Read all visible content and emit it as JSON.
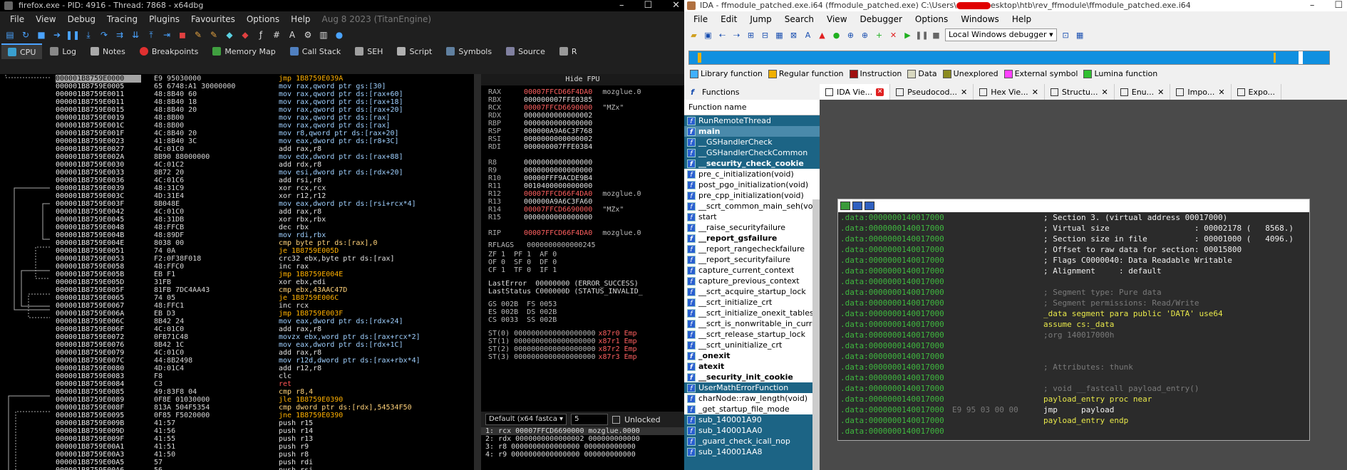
{
  "x64dbg": {
    "title": "firefox.exe - PID: 4916 - Thread: 7868 - x64dbg",
    "window_buttons": [
      "–",
      "☐",
      "✕"
    ],
    "menu": [
      "File",
      "View",
      "Debug",
      "Tracing",
      "Plugins",
      "Favourites",
      "Options",
      "Help"
    ],
    "version": "Aug 8 2023 (TitanEngine)",
    "tabs": [
      {
        "label": "CPU",
        "color": "#3aa0d0"
      },
      {
        "label": "Log",
        "color": "#888888"
      },
      {
        "label": "Notes",
        "color": "#aaaaaa"
      },
      {
        "label": "Breakpoints",
        "color": "#e03030"
      },
      {
        "label": "Memory Map",
        "color": "#40a040"
      },
      {
        "label": "Call Stack",
        "color": "#5080c0"
      },
      {
        "label": "SEH",
        "color": "#a0a0a0"
      },
      {
        "label": "Script",
        "color": "#b0b0b0"
      },
      {
        "label": "Symbols",
        "color": "#6080a0"
      },
      {
        "label": "Source",
        "color": "#8080a0"
      },
      {
        "label": "R",
        "color": "#999999"
      }
    ],
    "disasm": [
      [
        "000001B8759E0000",
        "E9 95030000",
        "jmp 1B8759E039A",
        "jmp"
      ],
      [
        "000001B8759E0005",
        "65 6748:A1 30000000",
        "mov rax,qword ptr gs:[30]",
        "mov"
      ],
      [
        "000001B8759E0011",
        "48:8B40 60",
        "mov rax,qword ptr ds:[rax+60]",
        "mov"
      ],
      [
        "000001B8759E0011",
        "48:8B40 18",
        "mov rax,qword ptr ds:[rax+18]",
        "mov"
      ],
      [
        "000001B8759E0015",
        "48:8B40 20",
        "mov rax,qword ptr ds:[rax+20]",
        "mov"
      ],
      [
        "000001B8759E0019",
        "48:8B00",
        "mov rax,qword ptr ds:[rax]",
        "mov"
      ],
      [
        "000001B8759E001C",
        "48:8B00",
        "mov rax,qword ptr ds:[rax]",
        "mov"
      ],
      [
        "000001B8759E001F",
        "4C:8B40 20",
        "mov r8,qword ptr ds:[rax+20]",
        "mov"
      ],
      [
        "000001B8759E0023",
        "41:8B40 3C",
        "mov eax,dword ptr ds:[r8+3C]",
        "mov"
      ],
      [
        "000001B8759E0027",
        "4C:01C0",
        "add rax,r8",
        ""
      ],
      [
        "000001B8759E002A",
        "8B90 88000000",
        "mov edx,dword ptr ds:[rax+88]",
        "mov"
      ],
      [
        "000001B8759E0030",
        "4C:01C2",
        "add rdx,r8",
        ""
      ],
      [
        "000001B8759E0033",
        "8B72 20",
        "mov esi,dword ptr ds:[rdx+20]",
        "mov"
      ],
      [
        "000001B8759E0036",
        "4C:01C6",
        "add rsi,r8",
        ""
      ],
      [
        "000001B8759E0039",
        "48:31C9",
        "xor rcx,rcx",
        ""
      ],
      [
        "000001B8759E003C",
        "4D:31E4",
        "xor r12,r12",
        ""
      ],
      [
        "000001B8759E003F",
        "8B048E",
        "mov eax,dword ptr ds:[rsi+rcx*4]",
        "mov"
      ],
      [
        "000001B8759E0042",
        "4C:01C0",
        "add rax,r8",
        ""
      ],
      [
        "000001B8759E0045",
        "48:31DB",
        "xor rbx,rbx",
        ""
      ],
      [
        "000001B8759E0048",
        "48:FFCB",
        "dec rbx",
        ""
      ],
      [
        "000001B8759E004B",
        "48:89DF",
        "mov rdi,rbx",
        "mov"
      ],
      [
        "000001B8759E004E",
        "8038 00",
        "cmp byte ptr ds:[rax],0",
        "cmp"
      ],
      [
        "000001B8759E0051",
        "74 0A",
        "je 1B8759E005D",
        "jmp"
      ],
      [
        "000001B8759E0053",
        "F2:0F38F018",
        "crc32 ebx,byte ptr ds:[rax]",
        ""
      ],
      [
        "000001B8759E0058",
        "48:FFC0",
        "inc rax",
        ""
      ],
      [
        "000001B8759E005B",
        "EB F1",
        "jmp 1B8759E004E",
        "jmp"
      ],
      [
        "000001B8759E005D",
        "31FB",
        "xor ebx,edi",
        ""
      ],
      [
        "000001B8759E005F",
        "81FB 7DC4AA43",
        "cmp ebx,43AAC47D",
        "cmp"
      ],
      [
        "000001B8759E0065",
        "74 05",
        "je 1B8759E006C",
        "jmp"
      ],
      [
        "000001B8759E0067",
        "48:FFC1",
        "inc rcx",
        ""
      ],
      [
        "000001B8759E006A",
        "EB D3",
        "jmp 1B8759E003F",
        "jmp"
      ],
      [
        "000001B8759E006C",
        "8B42 24",
        "mov eax,dword ptr ds:[rdx+24]",
        "mov"
      ],
      [
        "000001B8759E006F",
        "4C:01C0",
        "add rax,r8",
        ""
      ],
      [
        "000001B8759E0072",
        "0FB71C48",
        "movzx ebx,word ptr ds:[rax+rcx*2]",
        "mov"
      ],
      [
        "000001B8759E0076",
        "8B42 1C",
        "mov eax,dword ptr ds:[rdx+1C]",
        "mov"
      ],
      [
        "000001B8759E0079",
        "4C:01C0",
        "add rax,r8",
        ""
      ],
      [
        "000001B8759E007C",
        "44:8B2498",
        "mov r12d,dword ptr ds:[rax+rbx*4]",
        "mov"
      ],
      [
        "000001B8759E0080",
        "4D:01C4",
        "add r12,r8",
        ""
      ],
      [
        "000001B8759E0083",
        "F8",
        "clc",
        ""
      ],
      [
        "000001B8759E0084",
        "C3",
        "ret",
        "ret"
      ],
      [
        "000001B8759E0085",
        "49:83F8 04",
        "cmp r8,4",
        "cmp"
      ],
      [
        "000001B8759E0089",
        "0F8E 01030000",
        "jle 1B8759E0390",
        "jmp"
      ],
      [
        "000001B8759E008F",
        "813A 504F5354",
        "cmp dword ptr ds:[rdx],54534F50",
        "cmp"
      ],
      [
        "000001B8759E0095",
        "0F85 F5020000",
        "jne 1B8759E0390",
        "jmp"
      ],
      [
        "000001B8759E009B",
        "41:57",
        "push r15",
        ""
      ],
      [
        "000001B8759E009D",
        "41:56",
        "push r14",
        ""
      ],
      [
        "000001B8759E009F",
        "41:55",
        "push r13",
        ""
      ],
      [
        "000001B8759E00A1",
        "41:51",
        "push r9",
        ""
      ],
      [
        "000001B8759E00A3",
        "41:50",
        "push r8",
        ""
      ],
      [
        "000001B8759E00A5",
        "57",
        "push rdi",
        ""
      ],
      [
        "000001B8759E00A6",
        "56",
        "push rsi",
        ""
      ]
    ],
    "regs_header": "Hide FPU",
    "registers": [
      [
        "RAX",
        "00007FFCD66F4DA0",
        "mozglue.0",
        true
      ],
      [
        "RBX",
        "000000007FFE0385",
        "",
        false
      ],
      [
        "RCX",
        "00007FFCD6690000",
        "\"MZx\"",
        true
      ],
      [
        "RDX",
        "0000000000000002",
        "",
        false
      ],
      [
        "RBP",
        "0000000000000000",
        "",
        false
      ],
      [
        "RSP",
        "000000A9A6C3F768",
        "",
        false
      ],
      [
        "RSI",
        "0000000000000002",
        "",
        false
      ],
      [
        "RDI",
        "000000007FFE0384",
        "",
        false
      ],
      [
        "",
        "",
        "",
        false
      ],
      [
        "R8",
        "0000000000000000",
        "",
        false
      ],
      [
        "R9",
        "0000000000000000",
        "",
        false
      ],
      [
        "R10",
        "00000FFF9ACDE9B4",
        "",
        false
      ],
      [
        "R11",
        "0010400000000000",
        "",
        false
      ],
      [
        "R12",
        "00007FFCD66F4DA0",
        "mozglue.0",
        true
      ],
      [
        "R13",
        "000000A9A6C3FA60",
        "",
        false
      ],
      [
        "R14",
        "00007FFCD6690000",
        "\"MZx\"",
        true
      ],
      [
        "R15",
        "0000000000000000",
        "",
        false
      ],
      [
        "",
        "",
        "",
        false
      ],
      [
        "RIP",
        "00007FFCD66F4DA0",
        "mozglue.0",
        true
      ]
    ],
    "flags_line": "RFLAGS   0000000000000245",
    "flags": [
      "ZF 1  PF 1  AF 0",
      "OF 0  SF 0  DF 0",
      "CF 1  TF 0  IF 1"
    ],
    "last_error": "LastError  00000000 (ERROR_SUCCESS)",
    "last_status": "LastStatus C000000D (STATUS_INVALID_",
    "segs": [
      "GS 002B  FS 0053",
      "ES 002B  DS 002B",
      "CS 0033  SS 002B"
    ],
    "fpu": [
      [
        "ST(0) 0000000000000000000",
        "x87r0 Emp"
      ],
      [
        "ST(1) 0000000000000000000",
        "x87r1 Emp"
      ],
      [
        "ST(2) 0000000000000000000",
        "x87r2 Emp"
      ],
      [
        "ST(3) 0000000000000000000",
        "x87r3 Emp"
      ]
    ],
    "callconv": "Default (x64 fastca",
    "argcount": "5",
    "unlocked": "Unlocked",
    "stack": [
      "1: rcx 00007FFCD6690000 mozglue.0000",
      "2: rdx 0000000000000002 000000000000",
      "3: r8 0000000000000000 000000000000",
      "4: r9 0000000000000000 000000000000"
    ]
  },
  "ida": {
    "title_pre": "IDA - ffmodule_patched.exe.i64 (ffmodule_patched.exe) C:\\Users\\",
    "title_post": "esktop\\htb\\rev_ffmodule\\ffmodule_patched.exe.i64",
    "menu": [
      "File",
      "Edit",
      "Jump",
      "Search",
      "View",
      "Debugger",
      "Options",
      "Windows",
      "Help"
    ],
    "debugger": "Local Windows debugger",
    "legend": [
      {
        "label": "Library function",
        "color": "#40b0ff"
      },
      {
        "label": "Regular function",
        "color": "#f0b000"
      },
      {
        "label": "Instruction",
        "color": "#a01010"
      },
      {
        "label": "Data",
        "color": "#d8d8c0"
      },
      {
        "label": "Unexplored",
        "color": "#8a8a20"
      },
      {
        "label": "External symbol",
        "color": "#ff40ff"
      },
      {
        "label": "Lumina function",
        "color": "#30c030"
      }
    ],
    "functions_title": "Functions",
    "func_col": "Function name",
    "functions": [
      [
        "RunRemoteThread",
        "plain",
        false
      ],
      [
        "main",
        "gray",
        true
      ],
      [
        "__GSHandlerCheck",
        "plain",
        false
      ],
      [
        "__GSHandlerCheckCommon",
        "plain",
        false
      ],
      [
        "__security_check_cookie",
        "plain",
        true
      ],
      [
        "pre_c_initialization(void)",
        "light",
        false
      ],
      [
        "post_pgo_initialization(void)",
        "light",
        false
      ],
      [
        "pre_cpp_initialization(void)",
        "light",
        false
      ],
      [
        "__scrt_common_main_seh(voi",
        "light",
        false
      ],
      [
        "start",
        "light",
        false
      ],
      [
        "__raise_securityfailure",
        "light",
        false
      ],
      [
        "__report_gsfailure",
        "light",
        true
      ],
      [
        "__report_rangecheckfailure",
        "light",
        false
      ],
      [
        "__report_securityfailure",
        "light",
        false
      ],
      [
        "capture_current_context",
        "light",
        false
      ],
      [
        "capture_previous_context",
        "light",
        false
      ],
      [
        "__scrt_acquire_startup_lock",
        "light",
        false
      ],
      [
        "__scrt_initialize_crt",
        "light",
        false
      ],
      [
        "__scrt_initialize_onexit_tables",
        "light",
        false
      ],
      [
        "__scrt_is_nonwritable_in_curr",
        "light",
        false
      ],
      [
        "__scrt_release_startup_lock",
        "light",
        false
      ],
      [
        "__scrt_uninitialize_crt",
        "light",
        false
      ],
      [
        "_onexit",
        "light",
        true
      ],
      [
        "atexit",
        "light",
        true
      ],
      [
        "__security_init_cookie",
        "light",
        true
      ],
      [
        "UserMathErrorFunction",
        "plain",
        false
      ],
      [
        "charNode::raw_length(void)",
        "light",
        false
      ],
      [
        "_get_startup_file_mode",
        "light",
        false
      ],
      [
        "sub_140001A90",
        "plain",
        false
      ],
      [
        "sub_140001AA0",
        "plain",
        false
      ],
      [
        "_guard_check_icall_nop",
        "plain",
        false
      ],
      [
        "sub_140001AA8",
        "plain",
        false
      ]
    ],
    "tabs": [
      {
        "label": "IDA Vie...",
        "active": true
      },
      {
        "label": "Pseudocod...",
        "active": false
      },
      {
        "label": "Hex Vie...",
        "active": false
      },
      {
        "label": "Structu...",
        "active": false
      },
      {
        "label": "Enu...",
        "active": false
      },
      {
        "label": "Impo...",
        "active": false
      },
      {
        "label": "Expo...",
        "active": false
      }
    ],
    "listing": [
      [
        ".data:0000000140017000",
        "",
        "; Section 3. (virtual address 00017000)",
        "w"
      ],
      [
        ".data:0000000140017000",
        "",
        "; Virtual size                  : 00002178 (   8568.)",
        "w"
      ],
      [
        ".data:0000000140017000",
        "",
        "; Section size in file          : 00001000 (   4096.)",
        "w"
      ],
      [
        ".data:0000000140017000",
        "",
        "; Offset to raw data for section: 00015800",
        "w"
      ],
      [
        ".data:0000000140017000",
        "",
        "; Flags C0000040: Data Readable Writable",
        "w"
      ],
      [
        ".data:0000000140017000",
        "",
        "; Alignment     : default",
        "w"
      ],
      [
        ".data:0000000140017000",
        "",
        "",
        "w"
      ],
      [
        ".data:0000000140017000",
        "",
        "; Segment type: Pure data",
        "g"
      ],
      [
        ".data:0000000140017000",
        "",
        "; Segment permissions: Read/Write",
        "g"
      ],
      [
        ".data:0000000140017000",
        "",
        "_data segment para public 'DATA' use64",
        "y"
      ],
      [
        ".data:0000000140017000",
        "",
        "assume cs:_data",
        "y"
      ],
      [
        ".data:0000000140017000",
        "",
        ";org 140017000h",
        "g"
      ],
      [
        ".data:0000000140017000",
        "",
        "",
        "w"
      ],
      [
        ".data:0000000140017000",
        "",
        "",
        "w"
      ],
      [
        ".data:0000000140017000",
        "",
        "; Attributes: thunk",
        "g"
      ],
      [
        ".data:0000000140017000",
        "",
        "",
        "w"
      ],
      [
        ".data:0000000140017000",
        "",
        "; void __fastcall payload_entry()",
        "g"
      ],
      [
        ".data:0000000140017000",
        "",
        "payload_entry proc near",
        "y"
      ],
      [
        ".data:0000000140017000",
        "E9 95 03 00 00",
        "jmp     payload",
        "w"
      ],
      [
        ".data:0000000140017000",
        "",
        "payload_entry endp",
        "y"
      ],
      [
        ".data:0000000140017000",
        "",
        "",
        "w"
      ]
    ]
  }
}
